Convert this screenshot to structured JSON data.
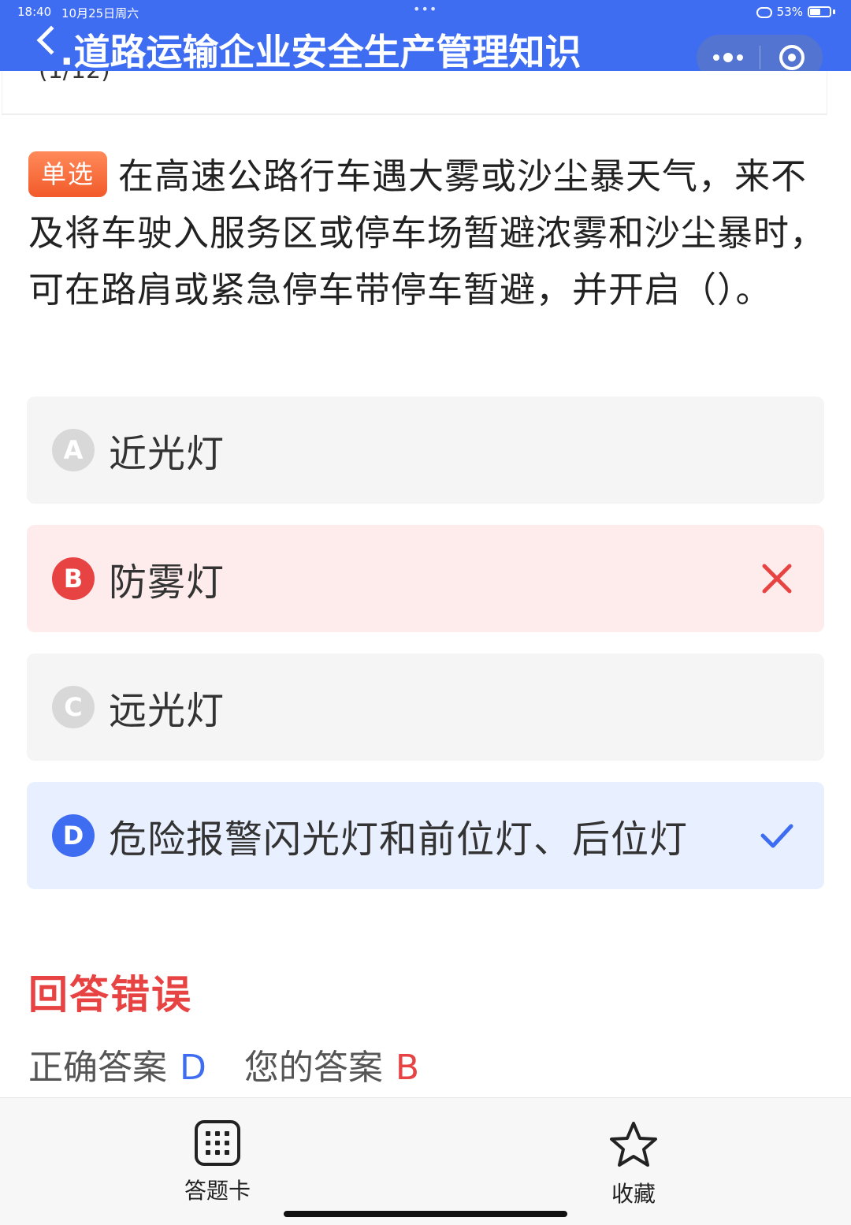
{
  "status_bar": {
    "time": "18:40",
    "date": "10月25日周六",
    "dots": "•••",
    "battery": "53%"
  },
  "nav": {
    "title": ".道路运输企业安全生产管理知识"
  },
  "prev_card": {
    "text": "(1/12)"
  },
  "question": {
    "type_tag": "单选",
    "text": "在高速公路行车遇大雾或沙尘暴天气，来不及将车驶入服务区或停车场暂避浓雾和沙尘暴时，可在路肩或紧急停车带停车暂避，并开启（）。"
  },
  "options": [
    {
      "letter": "A",
      "text": "近光灯",
      "state": "normal"
    },
    {
      "letter": "B",
      "text": "防雾灯",
      "state": "wrong"
    },
    {
      "letter": "C",
      "text": "远光灯",
      "state": "normal"
    },
    {
      "letter": "D",
      "text": "危险报警闪光灯和前位灯、后位灯",
      "state": "correct"
    }
  ],
  "result": {
    "title": "回答错误",
    "correct_label": "正确答案",
    "correct_value": "D",
    "your_label": "您的答案",
    "your_value": "B"
  },
  "bottom_bar": {
    "answer_card": "答题卡",
    "favorite": "收藏"
  },
  "colors": {
    "primary": "#3f6df2",
    "error": "#e84343",
    "tag": "#f25a2a"
  },
  "icons": {
    "back": "back-chevron-icon",
    "more": "more-dots-icon",
    "close": "close-ring-icon",
    "wrong": "cross-icon",
    "right": "check-icon",
    "answer_card": "grid-icon",
    "favorite": "star-icon"
  }
}
